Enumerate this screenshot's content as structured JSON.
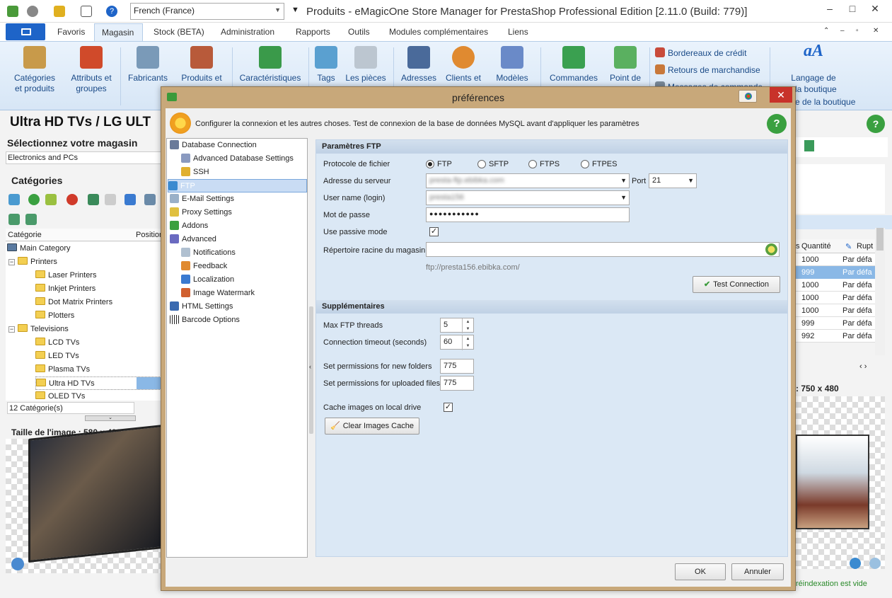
{
  "window": {
    "title": "Produits - eMagicOne Store Manager for PrestaShop Professional Edition [2.11.0 (Build: 779)]",
    "language": "French (France)"
  },
  "tabs": [
    "Favoris",
    "Magasin",
    "Stock (BETA)",
    "Administration",
    "Rapports",
    "Outils",
    "Modules complémentaires",
    "Liens"
  ],
  "ribbon": {
    "cats": "Catégories et produits",
    "attrs": "Attributs et groupes",
    "mfr": "Fabricants",
    "suppliers": "Produits et",
    "features": "Caractéristiques",
    "tags": "Tags",
    "attachments": "Les pièces",
    "addresses": "Adresses",
    "customers": "Clients et",
    "models": "Modèles",
    "orders": "Commandes",
    "points": "Point de",
    "credit": "Bordereaux de crédit",
    "returns": "Retours de marchandise",
    "messages": "Messages de commande",
    "lang1": "Langage de",
    "lang2": "la boutique",
    "lang3": "e de la boutique"
  },
  "left": {
    "title": "Ultra HD TVs / LG ULT",
    "select_store": "Sélectionnez votre magasin",
    "store": "Electronics and PCs",
    "categories_title": "Catégories",
    "col_category": "Catégorie",
    "col_position": "Position",
    "tree": [
      "Main Category",
      "Printers",
      "Laser Printers",
      "Inkjet Printers",
      "Dot Matrix Printers",
      "Plotters",
      "Televisions",
      "LCD TVs",
      "LED TVs",
      "Plasma TVs",
      "Ultra HD TVs",
      "OLED TVs"
    ],
    "count": "12 Catégorie(s)",
    "image_size": "Taille de l'image : 580 x 498"
  },
  "right": {
    "qty": "Quantité",
    "rupt": "Rupt",
    "rows": [
      [
        "1000",
        "Par défa"
      ],
      [
        "999",
        "Par défa"
      ],
      [
        "1000",
        "Par défa"
      ],
      [
        "1000",
        "Par défa"
      ],
      [
        "1000",
        "Par défa"
      ],
      [
        "999",
        "Par défa"
      ],
      [
        "992",
        "Par défa"
      ]
    ],
    "image_size": ": 750 x 480",
    "status": "réindexation est vide"
  },
  "dialog": {
    "title": "préférences",
    "desc": "Configurer la connexion et les autres choses. Test de connexion de la base de données MySQL avant d'appliquer les paramètres",
    "nav": [
      "Database Connection",
      "Advanced Database Settings",
      "SSH",
      "FTP",
      "E-Mail Settings",
      "Proxy Settings",
      "Addons",
      "Advanced",
      "Notifications",
      "Feedback",
      "Localization",
      "Image Watermark",
      "HTML Settings",
      "Barcode Options"
    ],
    "ftp_section": "Paramètres FTP",
    "protocol_label": "Protocole de fichier",
    "protocols": [
      "FTP",
      "SFTP",
      "FTPS",
      "FTPES"
    ],
    "server_label": "Adresse du serveur",
    "server_value": "presta-ftp.ebibka.com",
    "port_label": "Port",
    "port_value": "21",
    "user_label": "User name (login)",
    "user_value": "presta156",
    "pass_label": "Mot de passe",
    "pass_value": "●●●●●●●●●●●",
    "passive_label": "Use passive mode",
    "root_label": "Répertoire racine du magasin",
    "root_hint": "ftp://presta156.ebibka.com/",
    "test_btn": "Test Connection",
    "extra_section": "Supplémentaires",
    "threads_label": "Max FTP threads",
    "threads_value": "5",
    "timeout_label": "Connection timeout (seconds)",
    "timeout_value": "60",
    "perm_new_label": "Set permissions for new folders",
    "perm_new_value": "775",
    "perm_up_label": "Set permissions for uploaded files",
    "perm_up_value": "775",
    "cache_label": "Cache images on local drive",
    "clear_btn": "Clear Images Cache",
    "ok": "OK",
    "cancel": "Annuler"
  }
}
